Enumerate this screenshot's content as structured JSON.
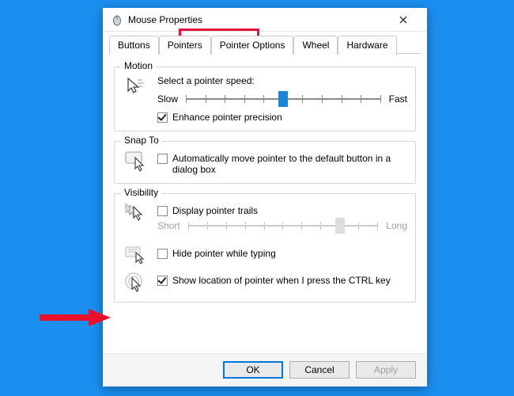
{
  "window": {
    "title": "Mouse Properties"
  },
  "tabs": {
    "items": [
      {
        "label": "Buttons"
      },
      {
        "label": "Pointers"
      },
      {
        "label": "Pointer Options"
      },
      {
        "label": "Wheel"
      },
      {
        "label": "Hardware"
      }
    ],
    "active_index": 2
  },
  "groups": {
    "motion": {
      "legend": "Motion",
      "speed_label": "Select a pointer speed:",
      "slow": "Slow",
      "fast": "Fast",
      "slider_value": 5,
      "slider_max": 10,
      "enhance_checked": true,
      "enhance_label": "Enhance pointer precision"
    },
    "snapto": {
      "legend": "Snap To",
      "auto_checked": false,
      "auto_label": "Automatically move pointer to the default button in a dialog box"
    },
    "visibility": {
      "legend": "Visibility",
      "trails_checked": false,
      "trails_label": "Display pointer trails",
      "short": "Short",
      "long": "Long",
      "trails_slider_value": 8,
      "trails_slider_max": 10,
      "hide_checked": false,
      "hide_label": "Hide pointer while typing",
      "ctrl_checked": true,
      "ctrl_label": "Show location of pointer when I press the CTRL key"
    }
  },
  "buttons": {
    "ok": "OK",
    "cancel": "Cancel",
    "apply": "Apply"
  }
}
